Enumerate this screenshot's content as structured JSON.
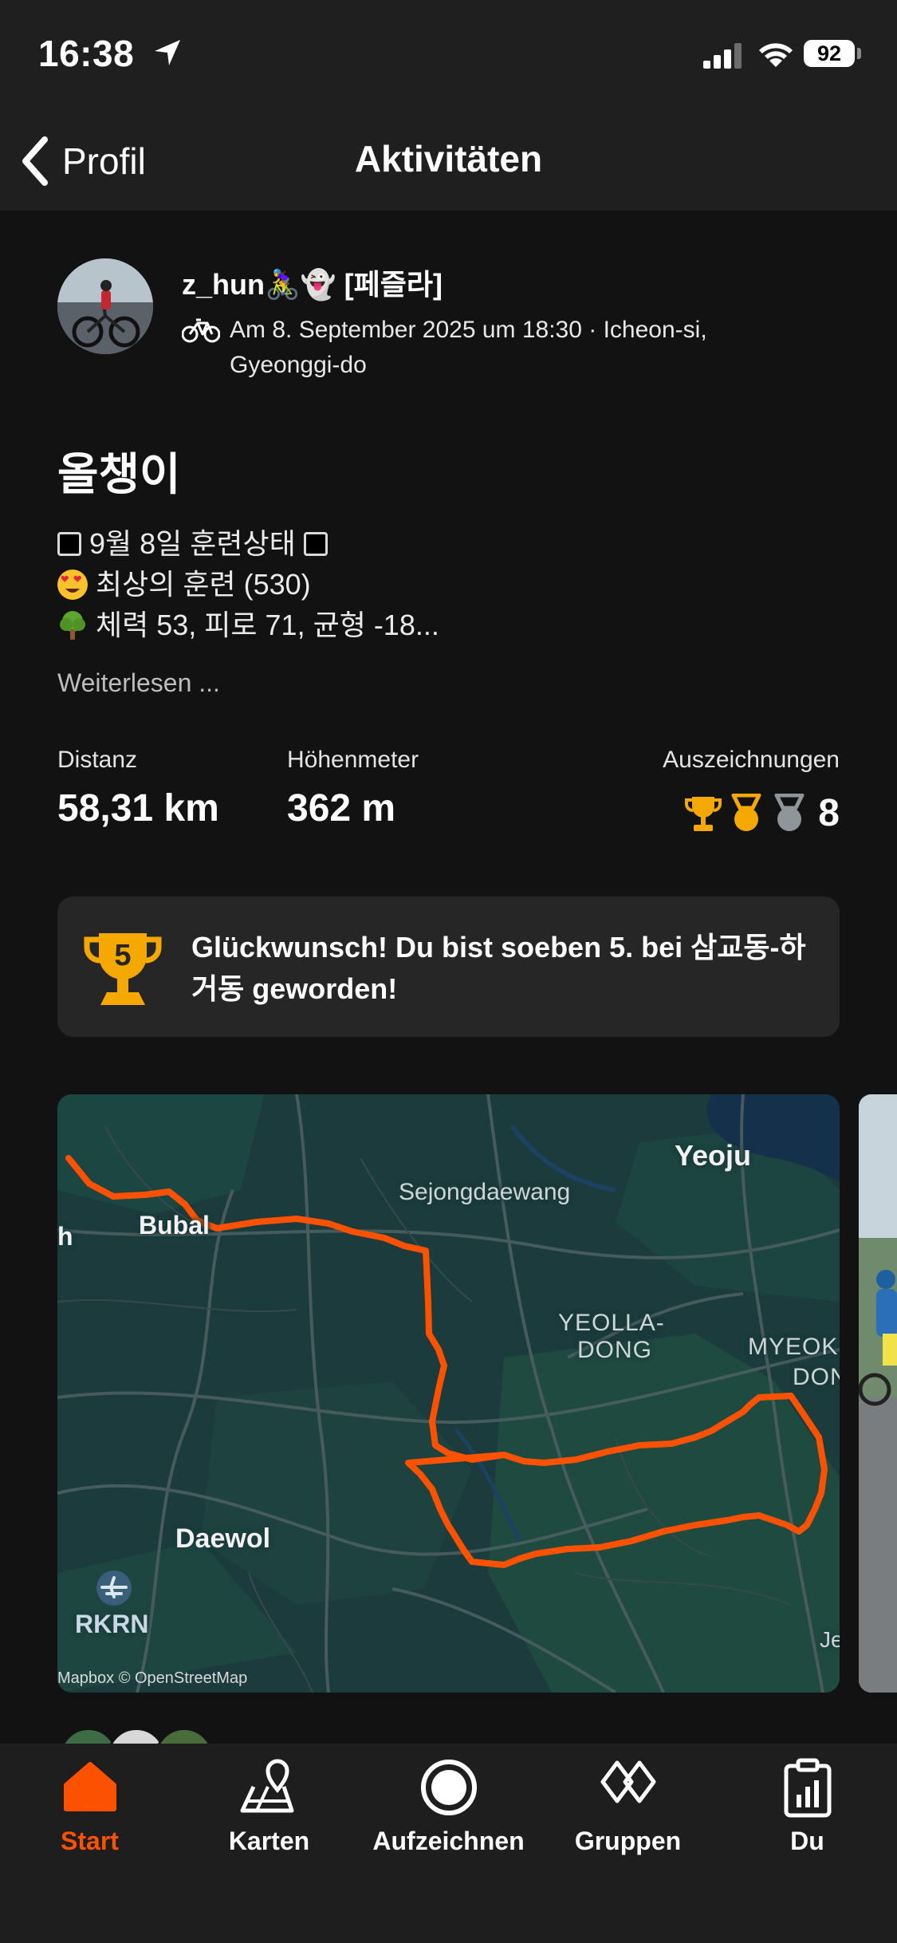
{
  "status_bar": {
    "time": "16:38",
    "battery": "92"
  },
  "nav": {
    "back_label": "Profil",
    "title": "Aktivitäten"
  },
  "activity": {
    "username": "z_hun🚴‍♀️👻 [페즐라]",
    "meta": "Am 8. September 2025 um 18:30 · Icheon-si, Gyeonggi-do",
    "title": "올챙이",
    "description_lines": [
      "9월 8일 훈련상태",
      "최상의 훈련 (530)",
      "체력 53, 피로 71, 균형 -18..."
    ],
    "read_more": "Weiterlesen ..."
  },
  "stats": {
    "distance_label": "Distanz",
    "distance_value": "58,31 km",
    "elevation_label": "Höhenmeter",
    "elevation_value": "362 m",
    "awards_label": "Auszeichnungen",
    "awards_count": "8"
  },
  "congrats": {
    "rank": "5",
    "text": "Glückwunsch! Du bist soeben 5. bei 삼교동-하거동 geworden!"
  },
  "map": {
    "labels": {
      "yeoju": "Yeoju",
      "sejong": "Sejongdaewang",
      "bubal": "Bubal",
      "h": "h",
      "yeolla": "YEOLLA-",
      "dong": "DONG",
      "myeok": "MYEOK",
      "don": "DON",
      "daewol": "Daewol",
      "rkrn": "RKRN",
      "je": "Je"
    },
    "attribution": "Mapbox © OpenStreetMap"
  },
  "tabs": [
    "Start",
    "Karten",
    "Aufzeichnen",
    "Gruppen",
    "Du"
  ],
  "colors": {
    "accent": "#fc5200",
    "gold": "#f5a800",
    "silver": "#8e969a",
    "map_bg": "#1b3b3c"
  }
}
